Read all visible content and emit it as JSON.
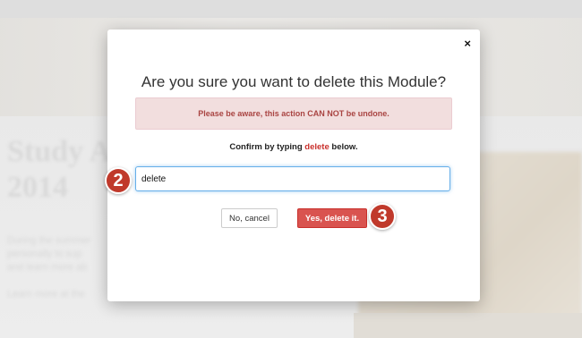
{
  "background": {
    "title_line1": "Study A",
    "title_line2": "2014",
    "text_line1": "During the summer",
    "text_line2": "personally to sup",
    "text_line3": "and learn more ab",
    "text_line4": "Learn more at the"
  },
  "modal": {
    "close_label": "×",
    "title": "Are you sure you want to delete this Module?",
    "warning": "Please be aware, this action CAN NOT be undone.",
    "confirm_prefix": "Confirm by typing ",
    "confirm_keyword": "delete",
    "confirm_suffix": " below.",
    "input_value": "delete",
    "cancel_label": "No, cancel",
    "delete_label": "Yes, delete it."
  },
  "annotations": {
    "step_input": "2",
    "step_delete": "3"
  },
  "colors": {
    "danger": "#d9534f",
    "warning_bg": "#f2dede",
    "warning_text": "#a94442",
    "focus_border": "#66afe9",
    "step_marker": "#c0392b"
  }
}
